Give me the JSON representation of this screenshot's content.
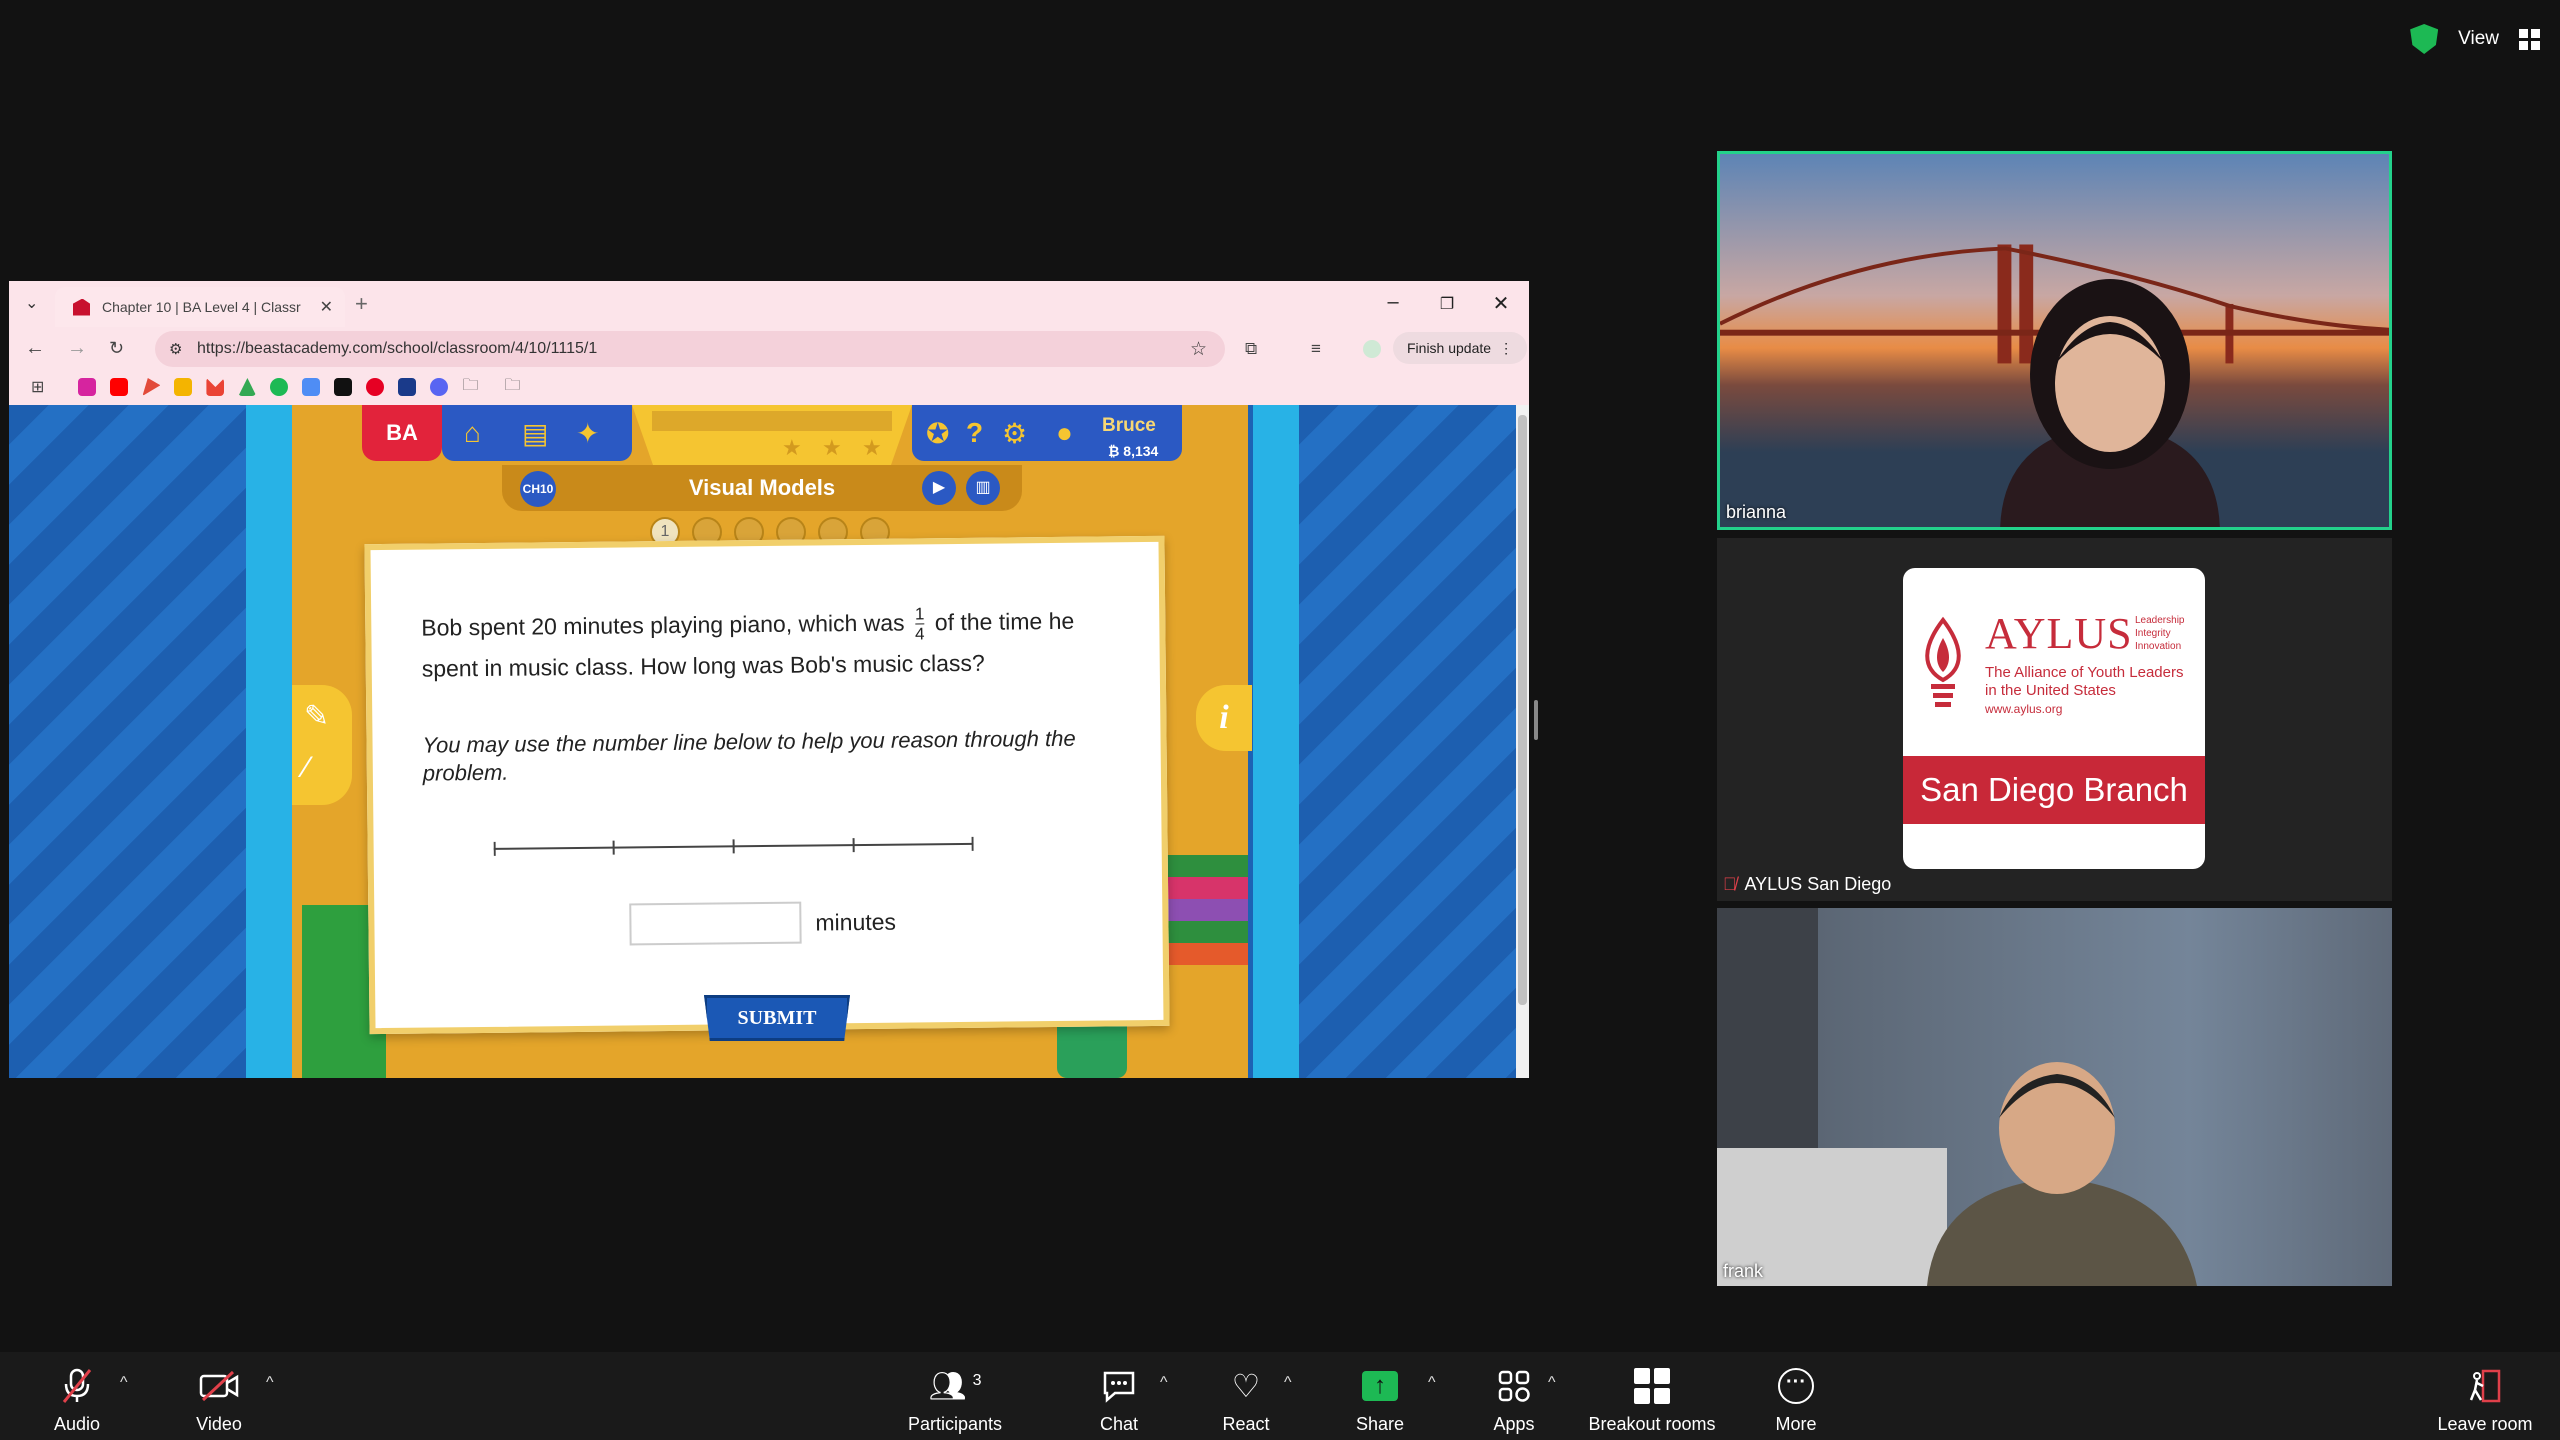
{
  "top_right": {
    "view_label": "View"
  },
  "browser": {
    "tab_title": "Chapter 10 | BA Level 4 | Classr",
    "url": "https://beastacademy.com/school/classroom/4/10/1115/1",
    "finish_update": "Finish update"
  },
  "game": {
    "logo": "BA",
    "user_name": "Bruce",
    "coins": "₿ 8,134",
    "chapter_badge": "CH10",
    "lesson_title": "Visual Models",
    "progress_dots": [
      "1",
      "",
      "",
      "",
      "",
      ""
    ],
    "problem_line1_before": "Bob spent 20 minutes playing piano, which was",
    "fraction_numerator": "1",
    "fraction_denominator": "4",
    "problem_line1_after": "of the time he",
    "problem_line2": "spent in music class. How long was Bob's music class?",
    "hint": "You may use the number line below to help you reason through the problem.",
    "answer_value": "",
    "answer_unit": "minutes",
    "submit_label": "SUBMIT",
    "info_label": "i"
  },
  "participants": [
    {
      "name": "brianna"
    },
    {
      "name": "AYLUS San Diego",
      "muted": true
    },
    {
      "name": "frank"
    }
  ],
  "aylus_logo": {
    "title": "AYLUS",
    "words": [
      "Leadership",
      "Integrity",
      "Innovation"
    ],
    "subtitle_lines": [
      "The Alliance of Youth Leaders",
      "in the United States"
    ],
    "url": "www.aylus.org",
    "branch": "San Diego Branch"
  },
  "toolbar": {
    "audio": "Audio",
    "video": "Video",
    "participants": "Participants",
    "participants_count": "3",
    "chat": "Chat",
    "react": "React",
    "share": "Share",
    "apps": "Apps",
    "breakout": "Breakout rooms",
    "more": "More",
    "leave": "Leave room"
  },
  "colors": {
    "active_speaker": "#23d18b",
    "share_green": "#1db954",
    "muted_red": "#e0404a"
  }
}
